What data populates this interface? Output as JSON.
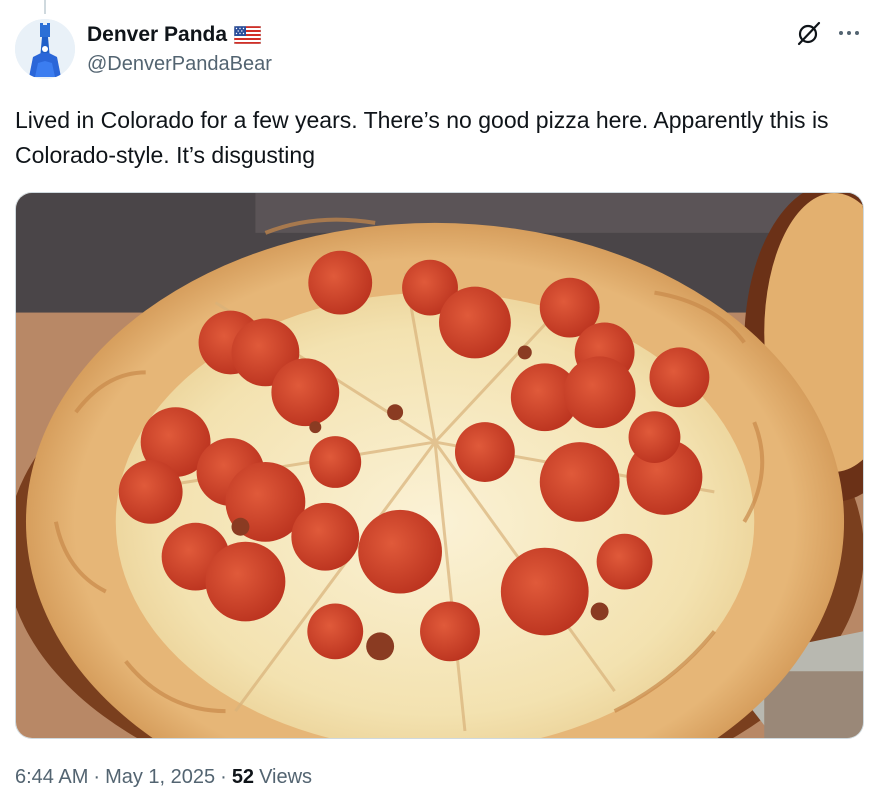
{
  "author": {
    "display_name": "Denver Panda",
    "flag_icon": "us-flag-icon",
    "handle": "@DenverPandaBear",
    "avatar_icon": "panda-avatar-icon"
  },
  "header_actions": {
    "grok_icon": "grok-slash-icon",
    "more_icon": "more-dots-icon"
  },
  "tweet": {
    "text": "Lived in Colorado for a few years. There’s no good pizza here. Apparently this is Colorado-style. It’s disgusting",
    "media_description": "photo-pizza"
  },
  "meta": {
    "time": "6:44 AM",
    "separator1": "·",
    "date": "May 1, 2025",
    "separator2": "·",
    "views_count": "52",
    "views_label": "Views"
  },
  "colors": {
    "text_primary": "#0f1419",
    "text_secondary": "#536471",
    "border": "#cfd9de"
  }
}
